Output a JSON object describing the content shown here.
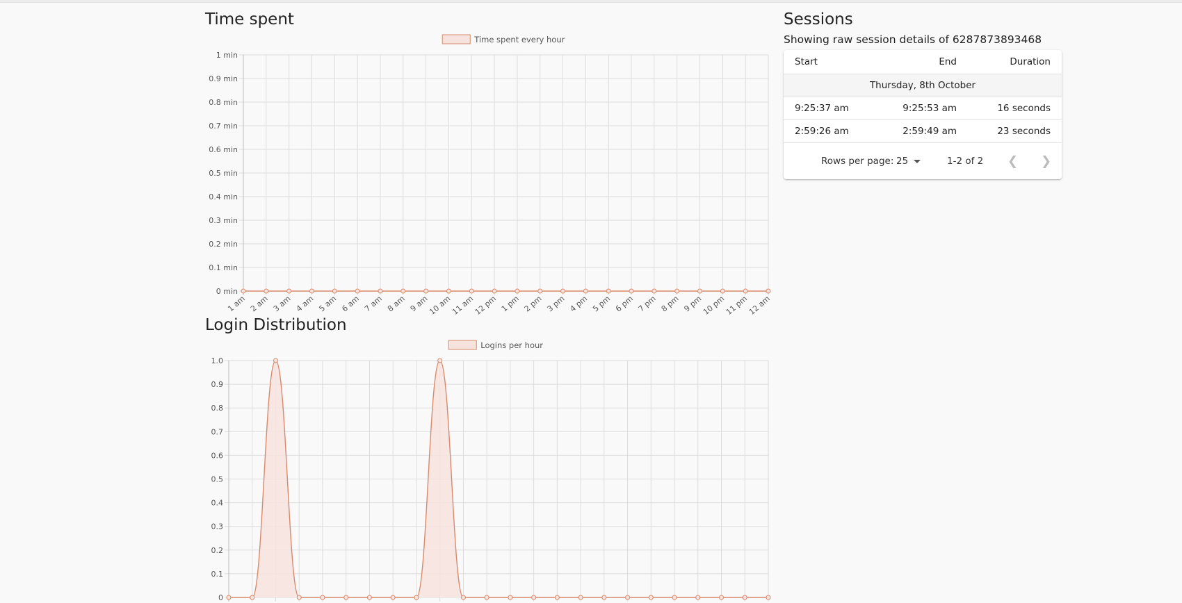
{
  "time_spent": {
    "title": "Time spent"
  },
  "login_distribution": {
    "title": "Login Distribution"
  },
  "sessions": {
    "title": "Sessions",
    "subtitle": "Showing raw session details of 6287873893468",
    "columns": {
      "start": "Start",
      "end": "End",
      "duration": "Duration"
    },
    "group_label": "Thursday, 8th October",
    "rows": [
      {
        "start": "9:25:37 am",
        "end": "9:25:53 am",
        "duration": "16 seconds"
      },
      {
        "start": "2:59:26 am",
        "end": "2:59:49 am",
        "duration": "23 seconds"
      }
    ],
    "footer": {
      "rows_per_page_label": "Rows per page:",
      "rows_per_page_value": "25",
      "range": "1-2 of 2"
    },
    "icons": {
      "prev": "chevron-left-icon",
      "next": "chevron-right-icon",
      "dropdown": "caret-down-icon"
    }
  },
  "colors": {
    "series_line": "#d9896b",
    "series_fill": "#f7e3de",
    "grid": "#dcdcdc"
  },
  "chart_data": [
    {
      "type": "line",
      "legend": "Time spent every hour",
      "legend_position": "top-center",
      "grid": true,
      "categories": [
        "1 am",
        "2 am",
        "3 am",
        "4 am",
        "5 am",
        "6 am",
        "7 am",
        "8 am",
        "9 am",
        "10 am",
        "11 am",
        "12 pm",
        "1 pm",
        "2 pm",
        "3 pm",
        "4 pm",
        "5 pm",
        "6 pm",
        "7 pm",
        "8 pm",
        "9 pm",
        "10 pm",
        "11 pm",
        "12 am"
      ],
      "values": [
        0,
        0,
        0,
        0,
        0,
        0,
        0,
        0,
        0,
        0,
        0,
        0,
        0,
        0,
        0,
        0,
        0,
        0,
        0,
        0,
        0,
        0,
        0,
        0
      ],
      "y_ticks": [
        "0 min",
        "0.1 min",
        "0.2 min",
        "0.3 min",
        "0.4 min",
        "0.5 min",
        "0.6 min",
        "0.7 min",
        "0.8 min",
        "0.9 min",
        "1 min"
      ],
      "ylim": [
        0,
        1
      ]
    },
    {
      "type": "area",
      "legend": "Logins per hour",
      "legend_position": "top-center",
      "grid": true,
      "points": 24,
      "values": [
        0,
        0,
        1,
        0,
        0,
        0,
        0,
        0,
        0,
        1,
        0,
        0,
        0,
        0,
        0,
        0,
        0,
        0,
        0,
        0,
        0,
        0,
        0,
        0
      ],
      "y_ticks": [
        "0",
        "0.1",
        "0.2",
        "0.3",
        "0.4",
        "0.5",
        "0.6",
        "0.7",
        "0.8",
        "0.9",
        "1.0"
      ],
      "ylim": [
        0,
        1
      ]
    }
  ]
}
